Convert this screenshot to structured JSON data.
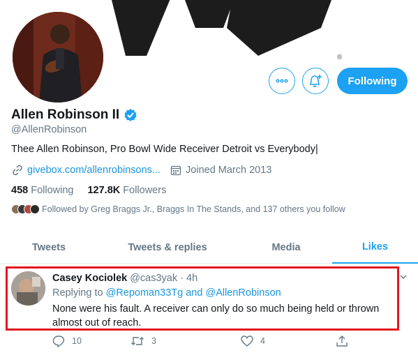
{
  "profile": {
    "name": "Allen Robinson II",
    "handle": "@AllenRobinson",
    "bio": "Thee Allen Robinson, Pro Bowl Wide Receiver Detroit vs Everybody|",
    "website": "givebox.com/allenrobinsons...",
    "joined": "Joined March 2013",
    "following_count": "458",
    "following_label": "Following",
    "followers_count": "127.8K",
    "followers_label": "Followers",
    "followed_by": "Followed by Greg Braggs Jr., Braggs In The Stands, and 137 others you follow",
    "follow_button": "Following"
  },
  "banner": {
    "reg_mark": "®"
  },
  "tabs": [
    {
      "label": "Tweets"
    },
    {
      "label": "Tweets & replies"
    },
    {
      "label": "Media"
    },
    {
      "label": "Likes"
    }
  ],
  "tweet": {
    "author": "Casey Kociolek",
    "meta": "@cas3yak · 4h",
    "replying_prefix": "Replying to",
    "replying_mentions": "@Repoman33Tg and @AllenRobinson",
    "text": "None were his fault. A receiver can only do so much being held or thrown almost out of reach.",
    "reply_count": "10",
    "retweet_count": "3",
    "like_count": "4"
  },
  "colors": {
    "accent": "#1da1f2",
    "link": "#1b95e0",
    "highlight_border": "#e0171f",
    "muted": "#657786"
  }
}
